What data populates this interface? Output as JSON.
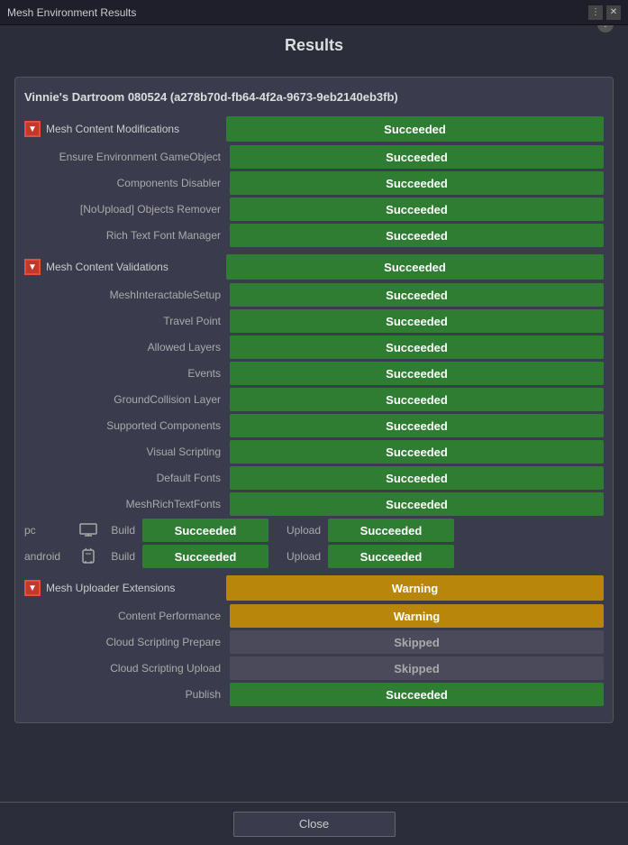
{
  "titlebar": {
    "title": "Mesh Environment Results",
    "more_icon": "⋮",
    "close_icon": "✕"
  },
  "page": {
    "title": "Results",
    "help_label": "?"
  },
  "env": {
    "name": "Vinnie's Dartroom 080524 (a278b70d-fb64-4f2a-9673-9eb2140eb3fb)"
  },
  "sections": {
    "mesh_content_modifications": {
      "label": "Mesh Content Modifications",
      "status": "Succeeded",
      "items": [
        {
          "label": "Ensure Environment GameObject",
          "status": "Succeeded"
        },
        {
          "label": "Components Disabler",
          "status": "Succeeded"
        },
        {
          "label": "[NoUpload] Objects Remover",
          "status": "Succeeded"
        },
        {
          "label": "Rich Text Font Manager",
          "status": "Succeeded"
        }
      ]
    },
    "mesh_content_validations": {
      "label": "Mesh Content Validations",
      "status": "Succeeded",
      "items": [
        {
          "label": "MeshInteractableSetup",
          "status": "Succeeded"
        },
        {
          "label": "Travel Point",
          "status": "Succeeded"
        },
        {
          "label": "Allowed Layers",
          "status": "Succeeded"
        },
        {
          "label": "Events",
          "status": "Succeeded"
        },
        {
          "label": "GroundCollision Layer",
          "status": "Succeeded"
        },
        {
          "label": "Supported Components",
          "status": "Succeeded"
        },
        {
          "label": "Visual Scripting",
          "status": "Succeeded"
        },
        {
          "label": "Default Fonts",
          "status": "Succeeded"
        },
        {
          "label": "MeshRichTextFonts",
          "status": "Succeeded"
        }
      ]
    },
    "platforms": {
      "pc": {
        "label": "pc",
        "icon": "🖥",
        "build_label": "Build",
        "build_status": "Succeeded",
        "upload_label": "Upload",
        "upload_status": "Succeeded"
      },
      "android": {
        "label": "android",
        "icon": "📱",
        "build_label": "Build",
        "build_status": "Succeeded",
        "upload_label": "Upload",
        "upload_status": "Succeeded"
      }
    },
    "mesh_uploader_extensions": {
      "label": "Mesh Uploader Extensions",
      "status": "Warning",
      "items": [
        {
          "label": "Content Performance",
          "status": "Warning",
          "type": "warning"
        },
        {
          "label": "Cloud Scripting Prepare",
          "status": "Skipped",
          "type": "skipped"
        },
        {
          "label": "Cloud Scripting Upload",
          "status": "Skipped",
          "type": "skipped"
        },
        {
          "label": "Publish",
          "status": "Succeeded",
          "type": "succeeded"
        }
      ]
    }
  },
  "footer": {
    "close_label": "Close"
  }
}
